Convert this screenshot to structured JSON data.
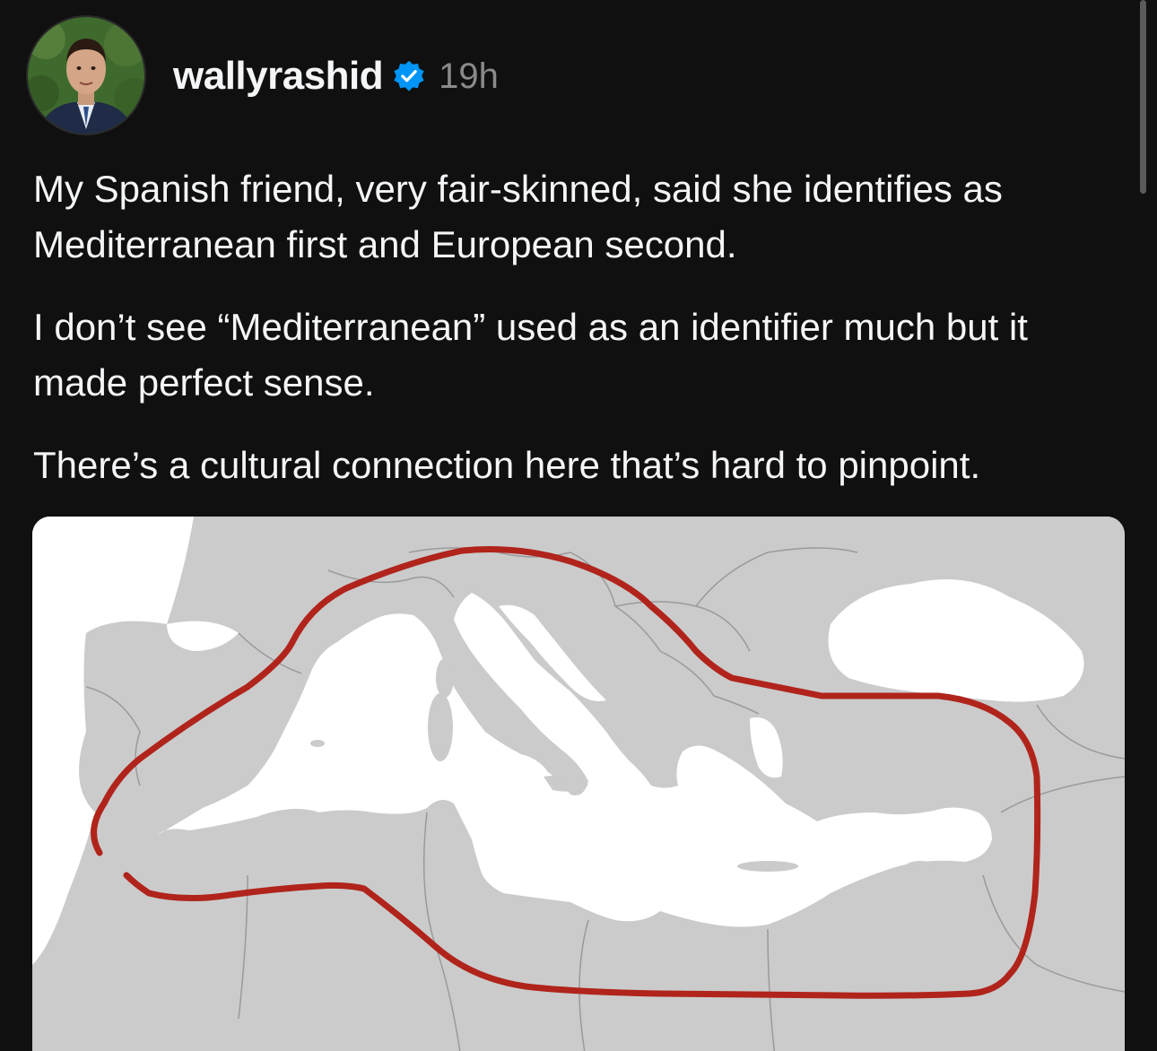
{
  "post": {
    "author": {
      "username": "wallyrashid",
      "verified": true,
      "avatar_icon": "profile-photo-icon"
    },
    "timestamp": "19h",
    "paragraphs": [
      "My Spanish friend, very fair-skinned, said she identifies as Mediterranean first and European second.",
      "I don’t see “Mediterranean” used as an identifier much but it made perfect sense.",
      "There’s a cultural connection here that’s hard to pinpoint."
    ],
    "media": {
      "type": "map",
      "icon": "mediterranean-map-image",
      "land_color": "#c9c9c9",
      "sea_color": "#ffffff",
      "outline_color": "#b0241b"
    }
  },
  "colors": {
    "background": "#101010",
    "text": "#f3f5f7",
    "muted": "#8a8a8a",
    "verified": "#0095f6"
  }
}
